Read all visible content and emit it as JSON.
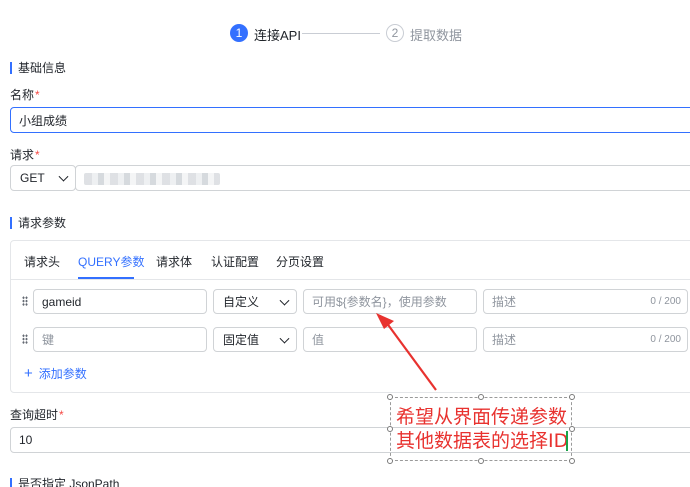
{
  "steps": [
    {
      "number": "1",
      "label": "连接API"
    },
    {
      "number": "2",
      "label": "提取数据"
    }
  ],
  "basic_info": {
    "section_title": "基础信息",
    "name_label": "名称",
    "name_value": "小组成绩",
    "request_label": "请求",
    "method": "GET"
  },
  "params": {
    "section_title": "请求参数",
    "tabs": [
      "请求头",
      "QUERY参数",
      "请求体",
      "认证配置",
      "分页设置"
    ],
    "rows": [
      {
        "key_value": "gameid",
        "key_placeholder": "",
        "type": "自定义",
        "value_placeholder": "可用${参数名}，使用参数",
        "desc_placeholder": "描述",
        "counter": "0 / 200"
      },
      {
        "key_value": "",
        "key_placeholder": "键",
        "type": "固定值",
        "value_placeholder": "值",
        "desc_placeholder": "描述",
        "counter": "0 / 200"
      }
    ],
    "add_label": "添加参数"
  },
  "timeout": {
    "label": "查询超时",
    "value": "10"
  },
  "jsonpath_label": "是否指定 JsonPath",
  "annotation": {
    "line1": "希望从界面传递参数",
    "line2": "其他数据表的选择ID",
    "color": "#e8322f"
  },
  "colors": {
    "accent": "#3370ff",
    "required": "#f54a45"
  }
}
